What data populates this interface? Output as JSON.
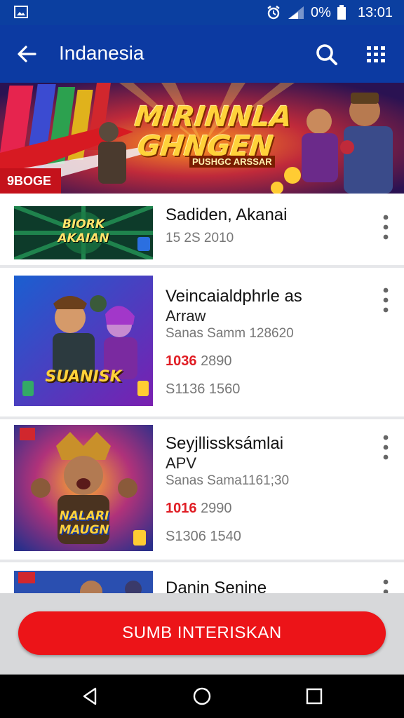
{
  "status_bar": {
    "battery_text": "0%",
    "time": "13:01",
    "icons": [
      "image-icon",
      "alarm-icon",
      "signal-icon",
      "battery-icon"
    ]
  },
  "app_bar": {
    "title": "Indanesia",
    "icons": [
      "back-arrow-icon",
      "search-icon",
      "grid-icon"
    ]
  },
  "banner": {
    "title_line1": "MIRINNLA",
    "title_line2": "GHNGEN",
    "tagline": "PUSHGC ARSSAR",
    "badge": "9BOGE"
  },
  "items": [
    {
      "name": "Sadiden, Akanai",
      "meta": "15 2S 2010",
      "thumb_title": "BIORK AKAIAN"
    },
    {
      "name": "Veincaialdphrle as",
      "sub": "Arraw",
      "meta": "Sanas Samm 128620",
      "sale_price": "1036",
      "price": "2890",
      "extra": "S1136 1560",
      "thumb_title": "SUANISK"
    },
    {
      "name": "Seyjllissksámlai",
      "sub": "APV",
      "meta": "Sanas Sama1161;30",
      "sale_price": "1016",
      "price": "2990",
      "extra": "S1306 1540",
      "thumb_title": "NALARI MAUGN"
    },
    {
      "name": "Danin Senine"
    }
  ],
  "cta_label": "SUMB INTERISKAN",
  "nav_bar": {
    "icons": [
      "back-triangle-icon",
      "home-circle-icon",
      "recents-square-icon"
    ]
  },
  "colors": {
    "app_bar": "#0c3aa2",
    "status_bar": "#0b3fa0",
    "accent_red": "#ec1418",
    "sale_red": "#e01d24"
  }
}
